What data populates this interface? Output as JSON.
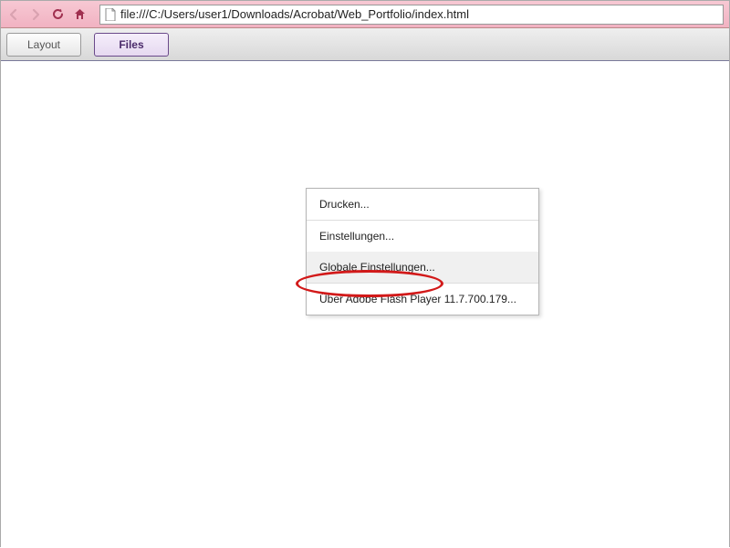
{
  "nav": {
    "url": "file:///C:/Users/user1/Downloads/Acrobat/Web_Portfolio/index.html"
  },
  "toolbar": {
    "layout_label": "Layout",
    "files_label": "Files"
  },
  "context_menu": {
    "print": "Drucken...",
    "settings": "Einstellungen...",
    "global_settings": "Globale Einstellungen...",
    "about": "Über Adobe Flash Player 11.7.700.179..."
  }
}
